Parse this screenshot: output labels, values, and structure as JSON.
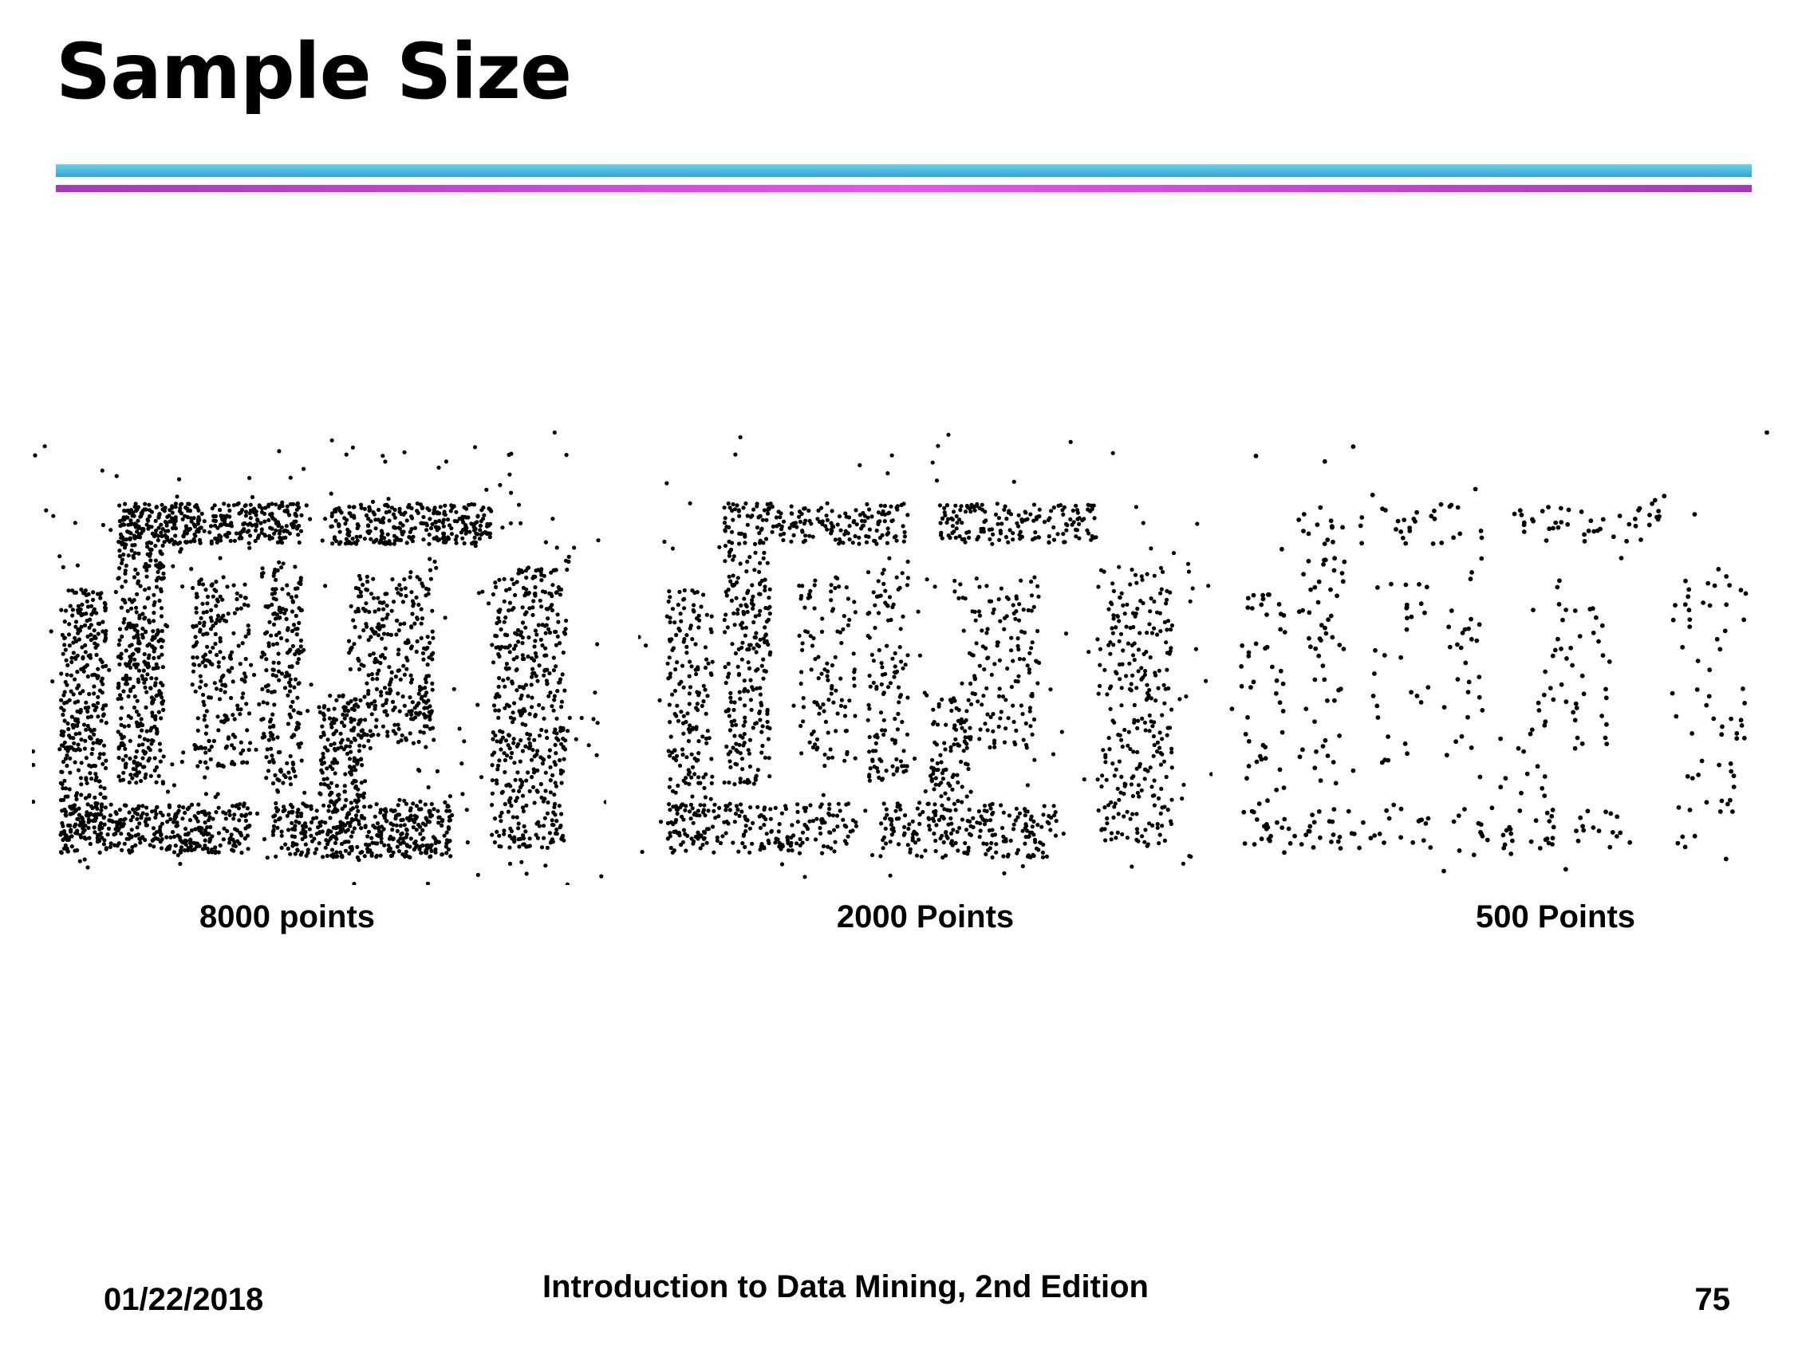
{
  "slide": {
    "title": "Sample Size",
    "footer_date": "01/22/2018",
    "footer_book": "Introduction to Data Mining, 2nd Edition",
    "page_number": "75"
  },
  "chart_data": [
    {
      "type": "scatter",
      "xlabel": "8000 points",
      "n_points": 8000,
      "color": "#000000",
      "grid": false
    },
    {
      "type": "scatter",
      "xlabel": "2000 Points",
      "n_points": 2000,
      "color": "#000000",
      "grid": false
    },
    {
      "type": "scatter",
      "xlabel": "500 Points",
      "n_points": 500,
      "color": "#000000",
      "grid": false
    }
  ]
}
